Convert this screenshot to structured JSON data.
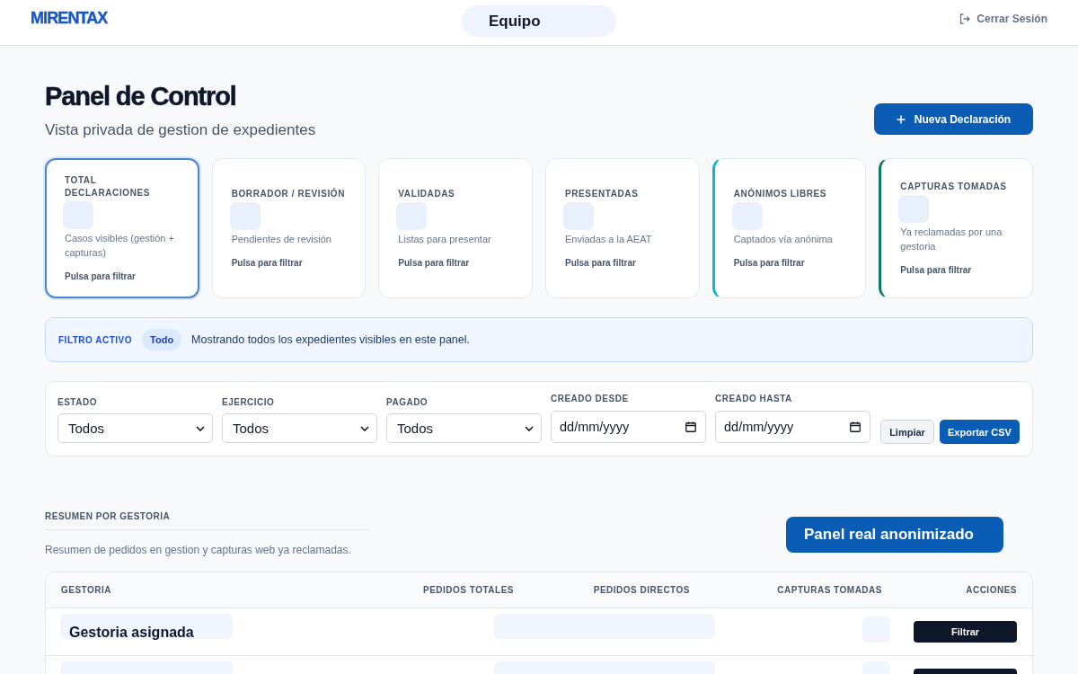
{
  "header": {
    "logo": "MIRENTAX",
    "team": "Equipo",
    "logout": "Cerrar Sesión"
  },
  "page": {
    "title": "Panel de Control",
    "subtitle": "Vista privada de gestion de expedientes",
    "primary_action": "Nueva Declaración"
  },
  "stat_cards": [
    {
      "label": "TOTAL DECLARACIONES",
      "description": "Casos visibles (gestión + capturas)",
      "hint": "Pulsa para filtrar",
      "selected": true
    },
    {
      "label": "BORRADOR / REVISIÓN",
      "description": "Pendientes de revisión",
      "hint": "Pulsa para filtrar",
      "selected": false
    },
    {
      "label": "VALIDADAS",
      "description": "Listas para presentar",
      "hint": "Pulsa para filtrar",
      "selected": false
    },
    {
      "label": "PRESENTADAS",
      "description": "Enviadas a la AEAT",
      "hint": "Pulsa para filtrar",
      "selected": false
    },
    {
      "label": "ANÓNIMOS LIBRES",
      "description": "Captados vía anónima",
      "hint": "Pulsa para filtrar",
      "selected": false,
      "color": "#06b6d4"
    },
    {
      "label": "CAPTURAS TOMADAS",
      "description": "Ya reclamadas por una gestoria",
      "hint": "Pulsa para filtrar",
      "selected": false,
      "color": "#0f766e"
    }
  ],
  "active_filter": {
    "label": "FILTRO ACTIVO",
    "value": "Todo",
    "message": "Mostrando todos los expedientes visibles en este panel."
  },
  "filters": {
    "fields": [
      {
        "kind": "select",
        "label": "ESTADO",
        "value": "Todos"
      },
      {
        "kind": "select",
        "label": "EJERCICIO",
        "value": "Todos"
      },
      {
        "kind": "select",
        "label": "PAGADO",
        "value": "Todos"
      },
      {
        "kind": "date",
        "label": "CREADO DESDE",
        "placeholder": "dd/mm/yyyy"
      },
      {
        "kind": "date",
        "label": "CREADO HASTA",
        "placeholder": "dd/mm/yyyy"
      }
    ],
    "buttons": [
      {
        "kind": "secondary",
        "label": "Limpiar"
      },
      {
        "kind": "primary",
        "label": "Exportar CSV"
      }
    ]
  },
  "summary": {
    "title": "RESUMEN POR GESTORIA",
    "description": "Resumen de pedidos en gestion y capturas web ya reclamadas.",
    "badge": "Panel real anonimizado",
    "table": {
      "columns": [
        "GESTORIA",
        "PEDIDOS TOTALES",
        "PEDIDOS DIRECTOS",
        "CAPTURAS TOMADAS",
        "ACCIONES"
      ],
      "rows": [
        {
          "kind": "full",
          "gestoria": "Gestoria asignada",
          "action": "Filtrar"
        },
        {
          "kind": "partial"
        }
      ]
    }
  }
}
